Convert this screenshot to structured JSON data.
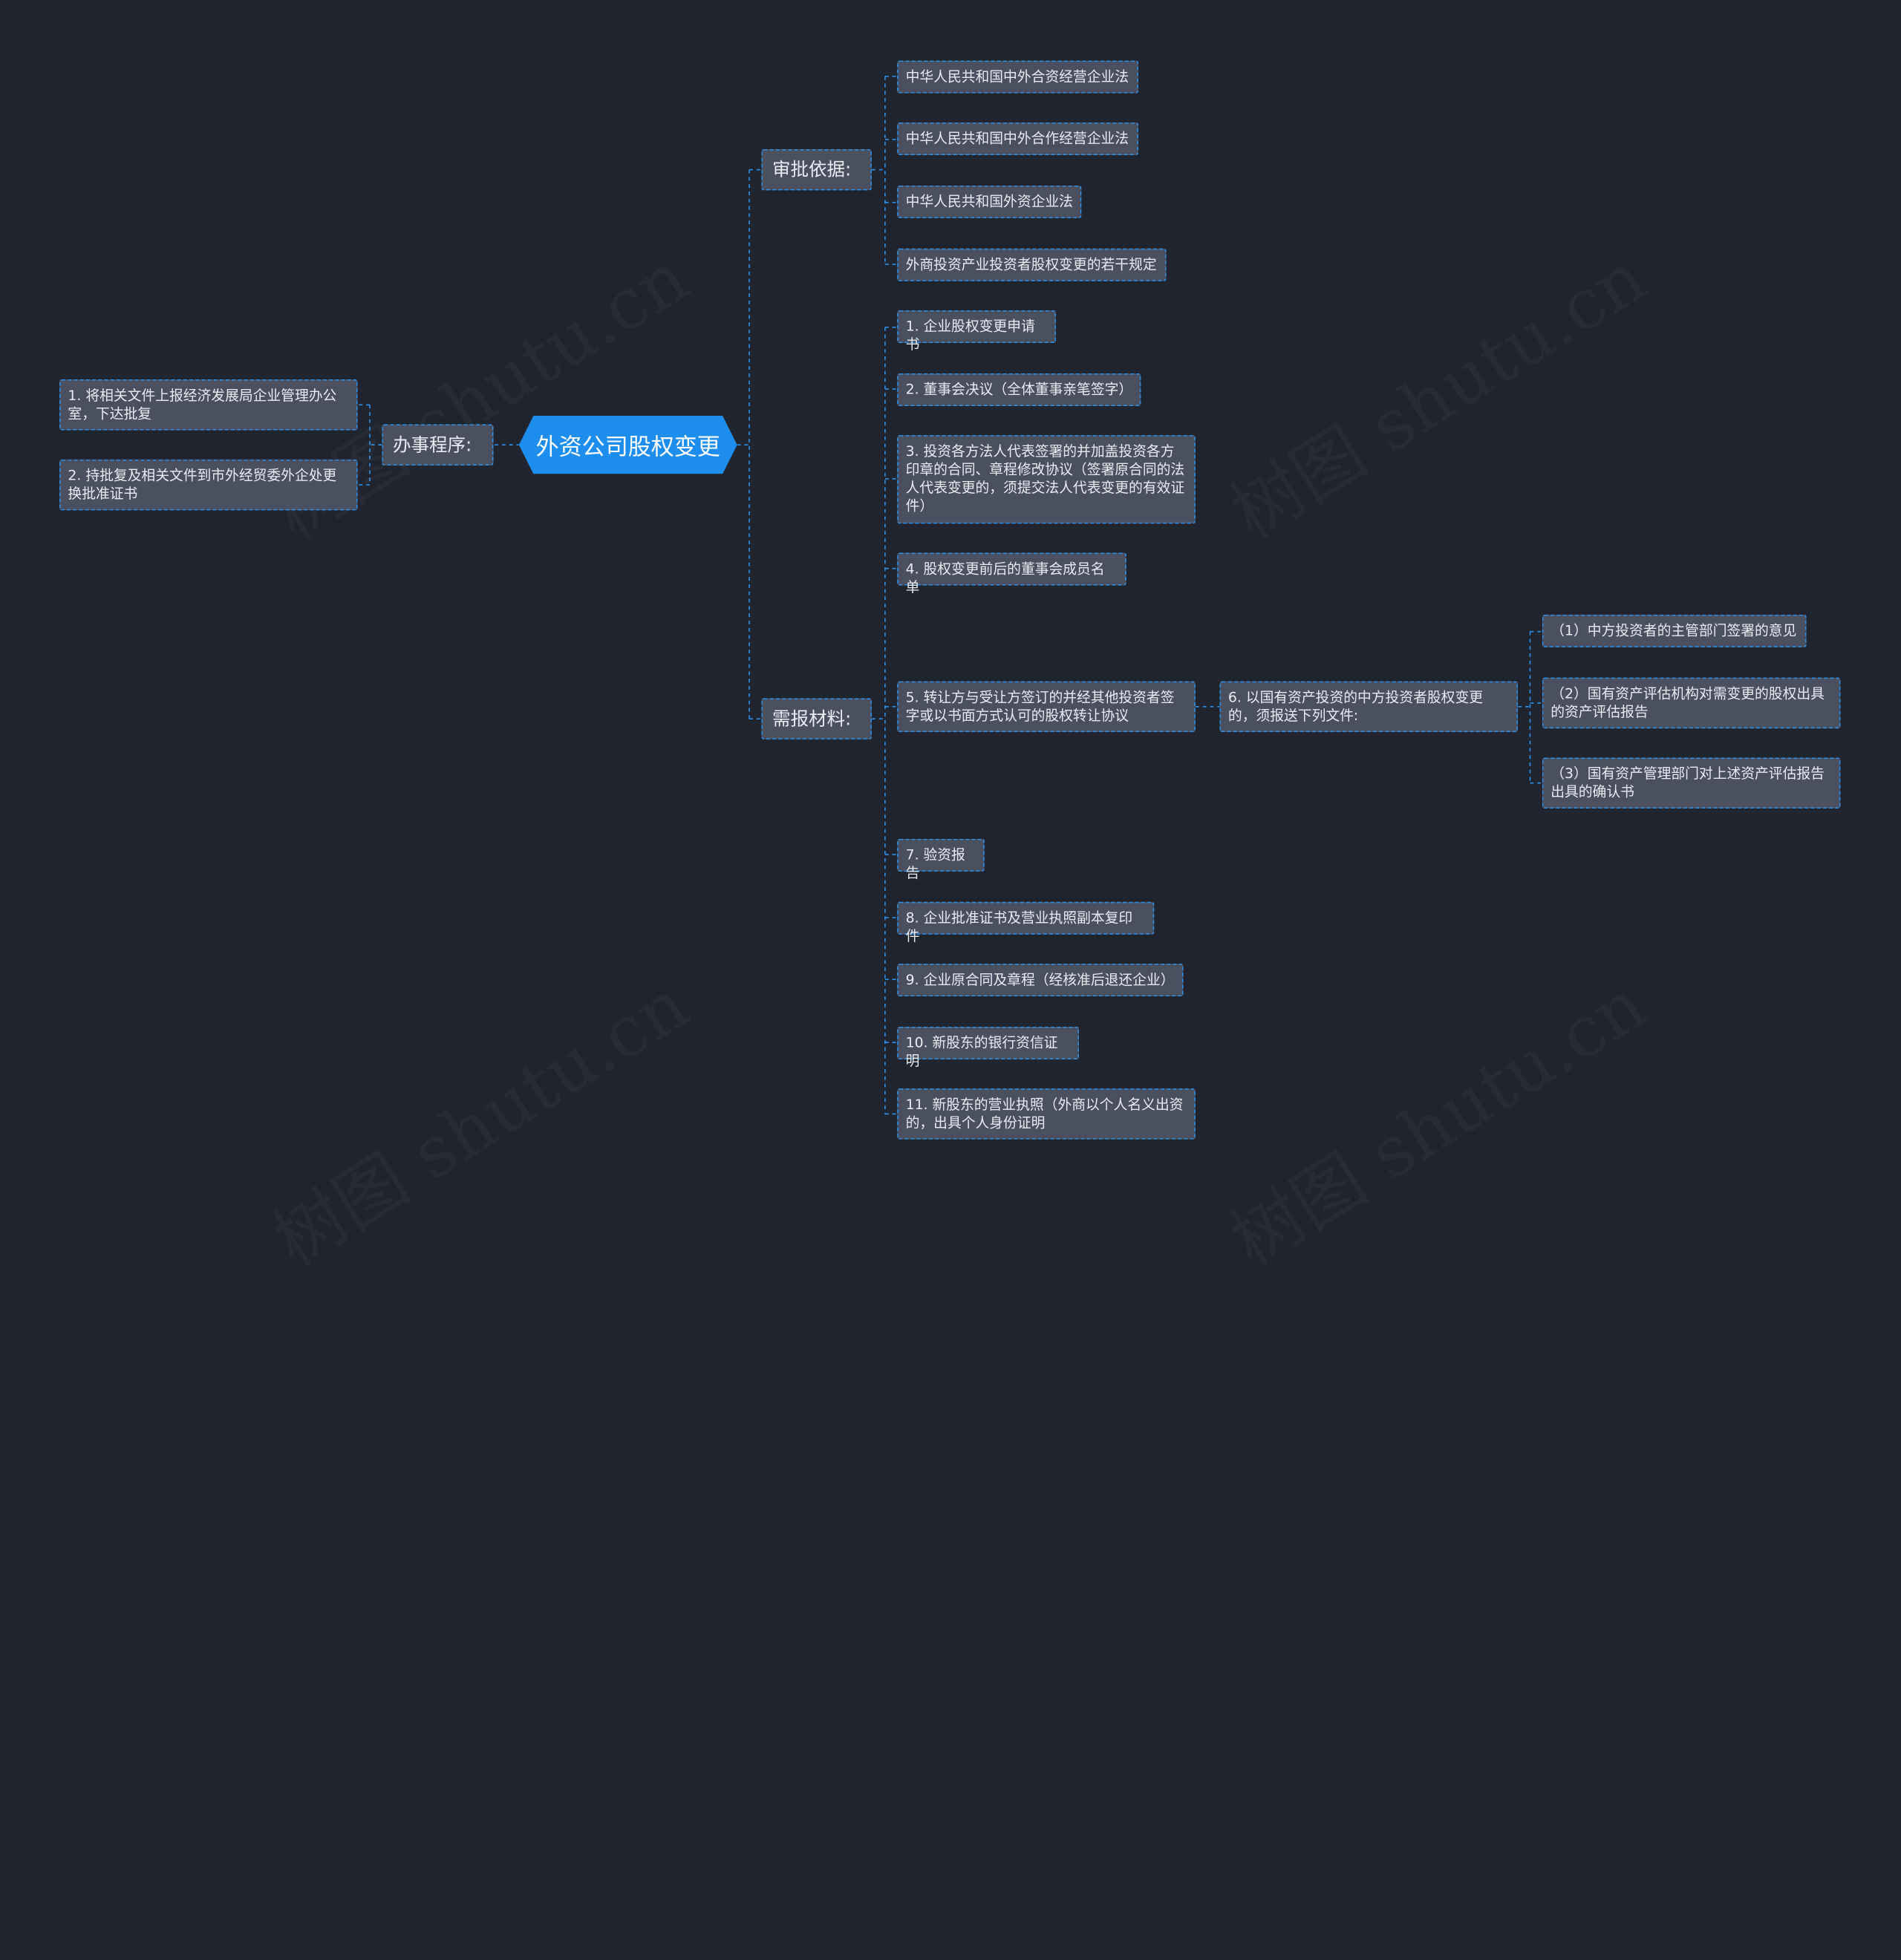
{
  "root": {
    "label": "外资公司股权变更"
  },
  "branches": {
    "procedure": {
      "label": "办事程序:",
      "items": [
        "1. 将相关文件上报经济发展局企业管理办公室，下达批复",
        "2. 持批复及相关文件到市外经贸委外企处更换批准证书"
      ]
    },
    "basis": {
      "label": "审批依据:",
      "items": [
        "中华人民共和国中外合资经营企业法",
        "中华人民共和国中外合作经营企业法",
        "中华人民共和国外资企业法",
        "外商投资产业投资者股权变更的若干规定"
      ]
    },
    "materials": {
      "label": "需报材料:",
      "items": [
        "1. 企业股权变更申请书",
        "2. 董事会决议（全体董事亲笔签字）",
        "3. 投资各方法人代表签署的并加盖投资各方印章的合同、章程修改协议（签署原合同的法人代表变更的，须提交法人代表变更的有效证件）",
        "4. 股权变更前后的董事会成员名单",
        "5. 转让方与受让方签订的并经其他投资者签字或以书面方式认可的股权转让协议",
        "7. 验资报告",
        "8. 企业批准证书及营业执照副本复印件",
        "9. 企业原合同及章程（经核准后退还企业）",
        "10. 新股东的银行资信证明",
        "11. 新股东的营业执照（外商以个人名义出资的，出具个人身份证明"
      ],
      "item6": {
        "label": "6. 以国有资产投资的中方投资者股权变更的，须报送下列文件:",
        "children": [
          "（1）中方投资者的主管部门签署的意见",
          "（2）国有资产评估机构对需变更的股权出具的资产评估报告",
          "（3）国有资产管理部门对上述资产评估报告出具的确认书"
        ]
      }
    }
  },
  "watermark": "树图 shutu.cn",
  "colors": {
    "background": "#20242f",
    "node_fill": "#4a5060",
    "accent": "#1e8eee",
    "connector": "#2f8fe6",
    "text": "#e9ecf2"
  }
}
